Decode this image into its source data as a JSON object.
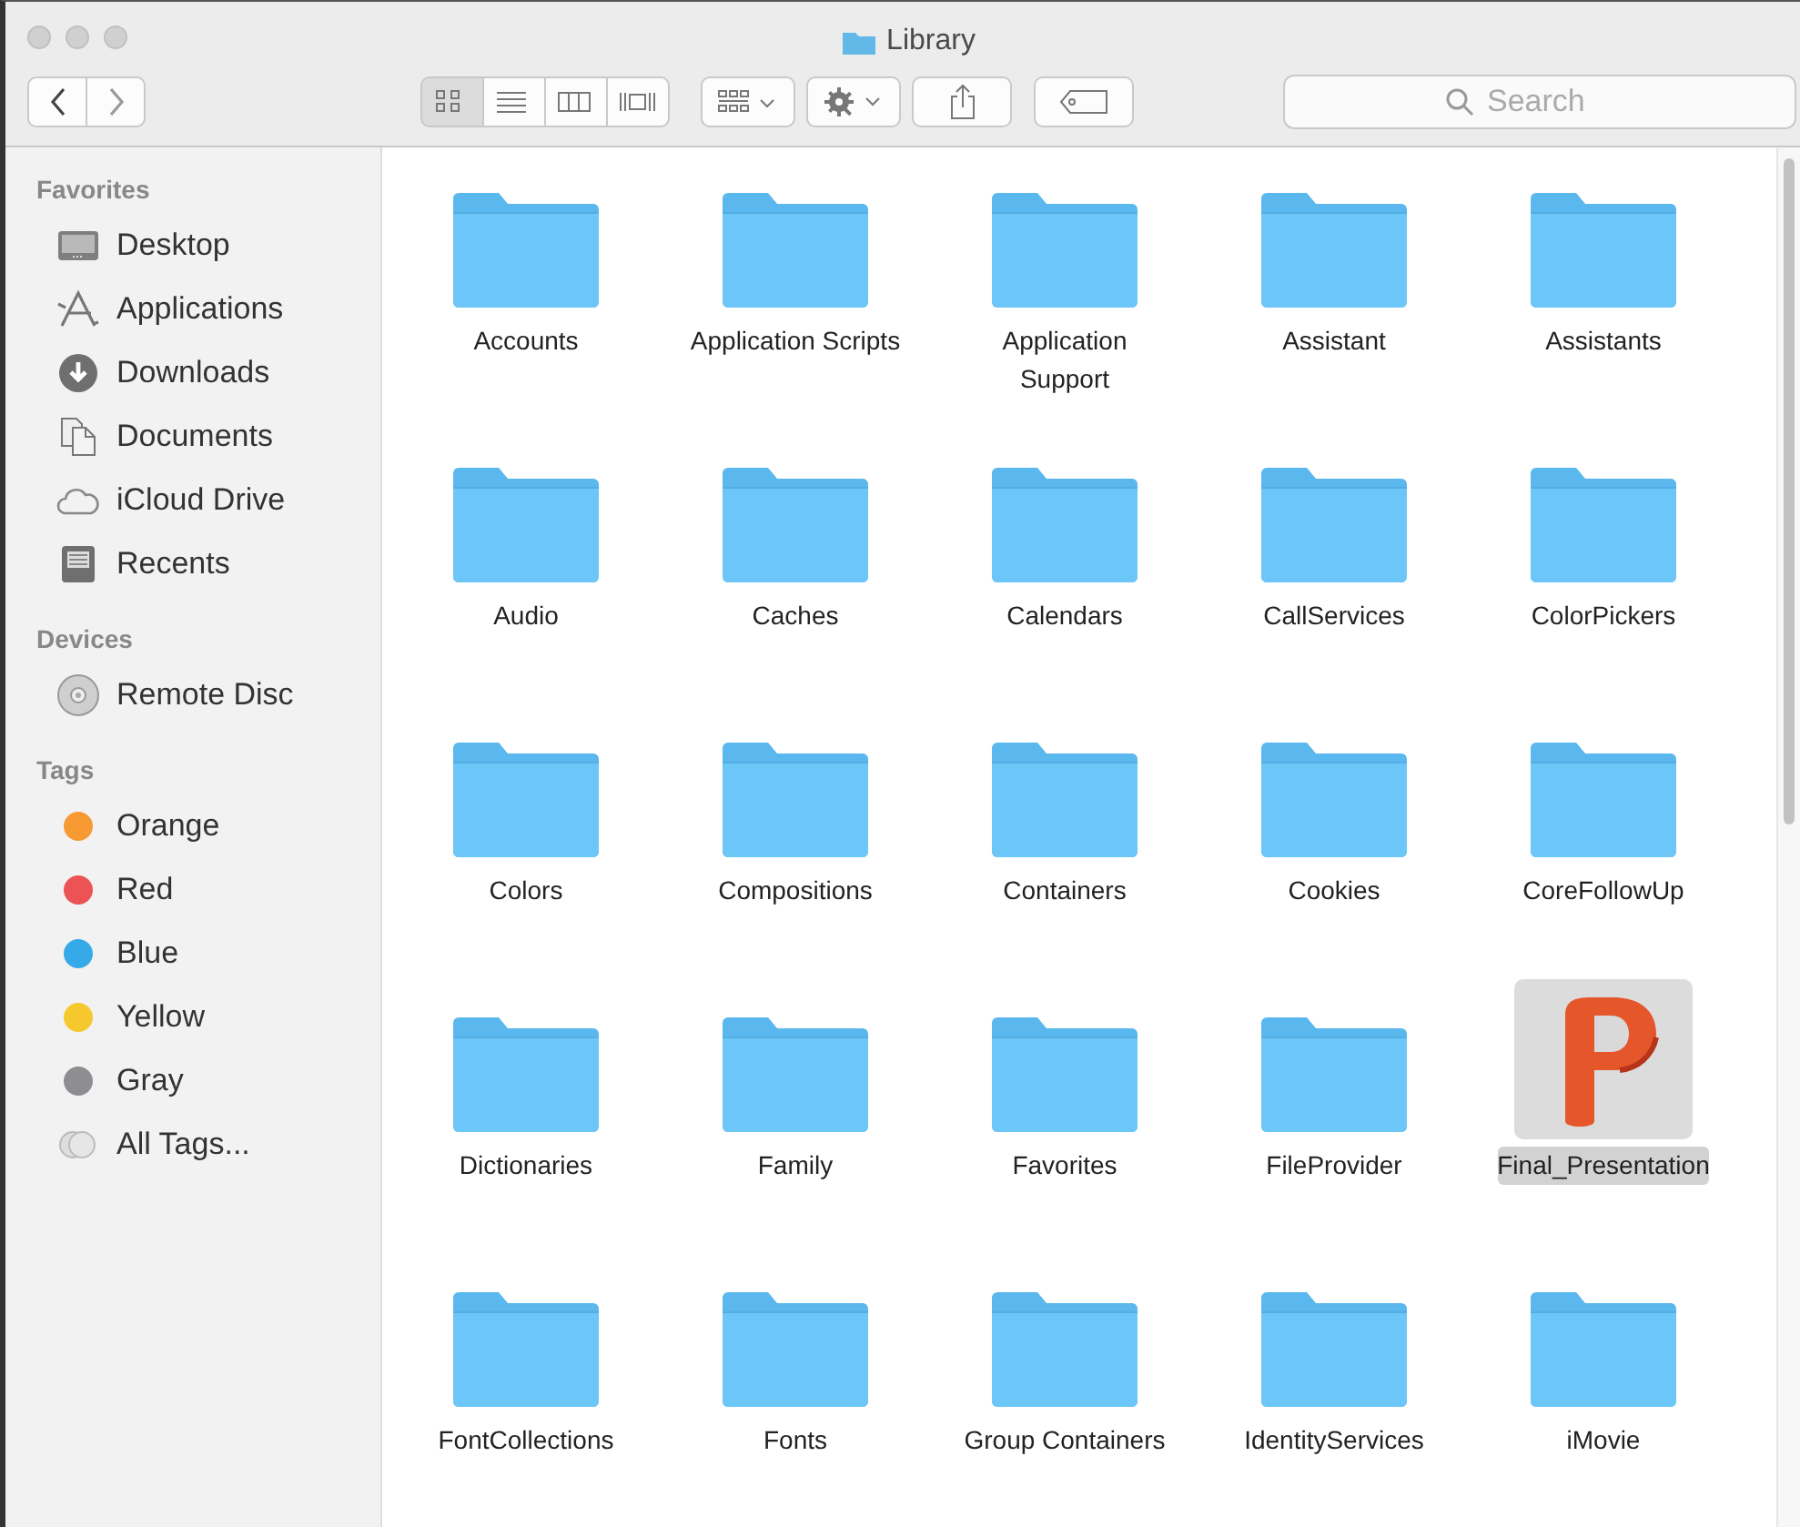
{
  "window": {
    "title": "Library"
  },
  "toolbar": {
    "views": [
      {
        "kind": "icon",
        "selected": true
      },
      {
        "kind": "list",
        "selected": false
      },
      {
        "kind": "columns",
        "selected": false
      },
      {
        "kind": "gallery",
        "selected": false
      }
    ],
    "search": {
      "placeholder": "Search"
    }
  },
  "sidebar": [
    {
      "heading": "Favorites",
      "items": [
        {
          "label": "Desktop",
          "kind": "desktop"
        },
        {
          "label": "Applications",
          "kind": "applications"
        },
        {
          "label": "Downloads",
          "kind": "downloads"
        },
        {
          "label": "Documents",
          "kind": "documents"
        },
        {
          "label": "iCloud Drive",
          "kind": "cloud"
        },
        {
          "label": "Recents",
          "kind": "recents"
        }
      ]
    },
    {
      "heading": "Devices",
      "items": [
        {
          "label": "Remote Disc",
          "kind": "disc"
        }
      ]
    },
    {
      "heading": "Tags",
      "items": [
        {
          "label": "Orange",
          "kind": "tag",
          "color": "#f79a33"
        },
        {
          "label": "Red",
          "kind": "tag",
          "color": "#ec5354"
        },
        {
          "label": "Blue",
          "kind": "tag",
          "color": "#36a9e8"
        },
        {
          "label": "Yellow",
          "kind": "tag",
          "color": "#f5c92e"
        },
        {
          "label": "Gray",
          "kind": "tag",
          "color": "#8e8e92"
        },
        {
          "label": "All Tags...",
          "kind": "all_tags"
        }
      ]
    }
  ],
  "files": [
    {
      "name": "Accounts",
      "kind": "folder",
      "selected": false
    },
    {
      "name": "Application Scripts",
      "kind": "folder",
      "selected": false
    },
    {
      "name": "Application Support",
      "kind": "folder",
      "selected": false
    },
    {
      "name": "Assistant",
      "kind": "folder",
      "selected": false
    },
    {
      "name": "Assistants",
      "kind": "folder",
      "selected": false
    },
    {
      "name": "Audio",
      "kind": "folder",
      "selected": false
    },
    {
      "name": "Caches",
      "kind": "folder",
      "selected": false
    },
    {
      "name": "Calendars",
      "kind": "folder",
      "selected": false
    },
    {
      "name": "CallServices",
      "kind": "folder",
      "selected": false
    },
    {
      "name": "ColorPickers",
      "kind": "folder",
      "selected": false
    },
    {
      "name": "Colors",
      "kind": "folder",
      "selected": false
    },
    {
      "name": "Compositions",
      "kind": "folder",
      "selected": false
    },
    {
      "name": "Containers",
      "kind": "folder",
      "selected": false
    },
    {
      "name": "Cookies",
      "kind": "folder",
      "selected": false
    },
    {
      "name": "CoreFollowUp",
      "kind": "folder",
      "selected": false
    },
    {
      "name": "Dictionaries",
      "kind": "folder",
      "selected": false
    },
    {
      "name": "Family",
      "kind": "folder",
      "selected": false
    },
    {
      "name": "Favorites",
      "kind": "folder",
      "selected": false
    },
    {
      "name": "FileProvider",
      "kind": "folder",
      "selected": false
    },
    {
      "name": "Final_Presentation",
      "kind": "presentation",
      "selected": true
    },
    {
      "name": "FontCollections",
      "kind": "folder",
      "selected": false
    },
    {
      "name": "Fonts",
      "kind": "folder",
      "selected": false
    },
    {
      "name": "Group Containers",
      "kind": "folder",
      "selected": false
    },
    {
      "name": "IdentityServices",
      "kind": "folder",
      "selected": false
    },
    {
      "name": "iMovie",
      "kind": "folder",
      "selected": false
    }
  ]
}
